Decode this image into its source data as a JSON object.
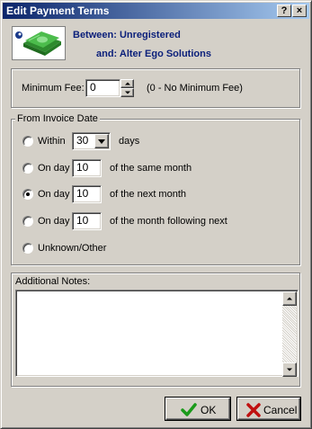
{
  "window": {
    "title": "Edit Payment Terms",
    "help_label": "?",
    "close_label": "×"
  },
  "header": {
    "between_label": "Between:",
    "between_value": "Unregistered",
    "and_label": "and:",
    "and_value": "Alter Ego Solutions",
    "icon": "money-stack-icon"
  },
  "minimum_fee": {
    "label": "Minimum Fee:",
    "value": "0",
    "hint": "(0 - No Minimum Fee)"
  },
  "invoice_group": {
    "title": "From Invoice Date",
    "options": [
      {
        "label": "Within",
        "value": "30",
        "suffix": "days",
        "checked": false
      },
      {
        "label": "On day",
        "value": "10",
        "suffix": "of the same month",
        "checked": false
      },
      {
        "label": "On day",
        "value": "10",
        "suffix": "of the next month",
        "checked": true
      },
      {
        "label": "On day",
        "value": "10",
        "suffix": "of the month following next",
        "checked": false
      },
      {
        "label": "Unknown/Other",
        "checked": false
      }
    ]
  },
  "notes": {
    "label": "Additional Notes:",
    "value": ""
  },
  "footer": {
    "ok_label": "OK",
    "cancel_label": "Cancel"
  },
  "colors": {
    "title_gradient_start": "#0a246a",
    "title_gradient_end": "#a6caf0",
    "header_text": "#0a1f7a",
    "face": "#d4d0c8",
    "ok_check": "#1a9a1a",
    "cancel_x": "#c01010"
  }
}
